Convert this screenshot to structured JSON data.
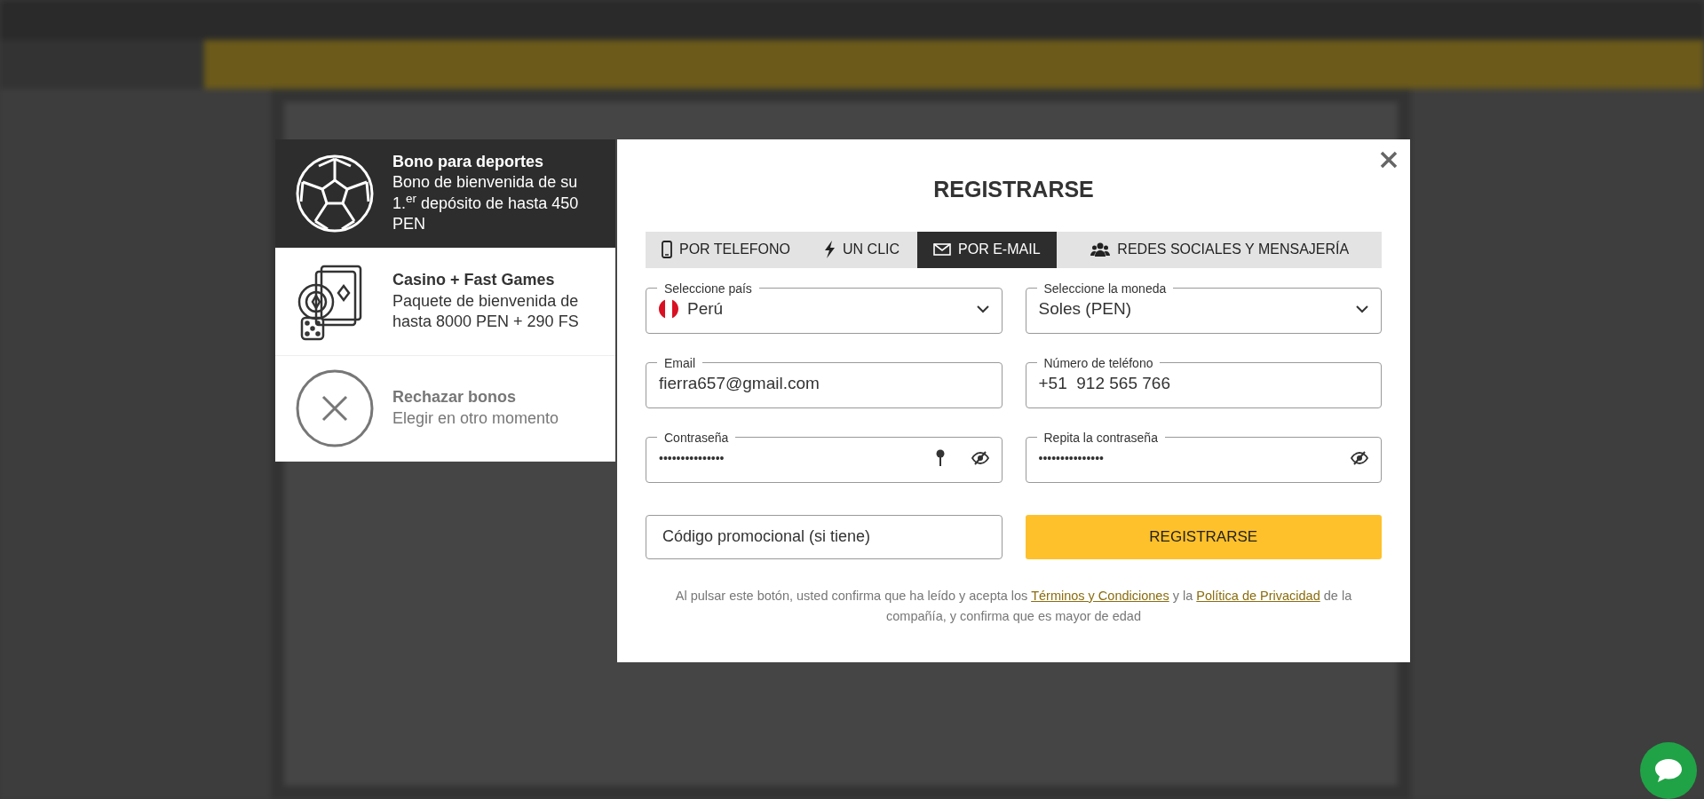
{
  "bonus_options": [
    {
      "kind": "sports",
      "title": "Bono para deportes",
      "description": "Bono de bienvenida de su 1.$^{er}$ depósito de hasta 450 PEN",
      "selected": true
    },
    {
      "kind": "casino",
      "title": "Casino + Fast Games",
      "description": "Paquete de bienvenida de hasta 8000 PEN + 290 FS",
      "selected": false
    },
    {
      "kind": "decline",
      "title": "Rechazar bonos",
      "description": "Elegir en otro momento",
      "selected": false
    }
  ],
  "dialog": {
    "title": "REGISTRARSE",
    "tabs": [
      {
        "kind": "phone",
        "label": "POR TELEFONO",
        "selected": false
      },
      {
        "kind": "oneclick",
        "label": "UN CLIC",
        "selected": false
      },
      {
        "kind": "email",
        "label": "POR E-MAIL",
        "selected": true
      },
      {
        "kind": "social",
        "label": "REDES SOCIALES Y MENSAJERÍA",
        "selected": false
      }
    ],
    "fields": [
      {
        "kind": "country",
        "label": "Seleccione país",
        "value": "Perú"
      },
      {
        "kind": "select",
        "label": "Seleccione la moneda",
        "value": "Soles (PEN)"
      },
      {
        "kind": "text",
        "label": "Email",
        "value": "fierra657@gmail.com"
      },
      {
        "kind": "text",
        "label": "Número de teléfono",
        "value": "+51  912 565 766"
      },
      {
        "kind": "password_key",
        "label": "Contraseña",
        "value": "•••••••••••••••"
      },
      {
        "kind": "password",
        "label": "Repita la contraseña",
        "value": "•••••••••••••••"
      }
    ],
    "promo": {
      "placeholder": "Código promocional (si tiene)"
    },
    "submit": "REGISTRARSE",
    "consent": [
      {
        "kind": "text",
        "text": "Al pulsar este botón, usted confirma que ha leído y acepta los "
      },
      {
        "kind": "link",
        "text": "Términos y Condiciones"
      },
      {
        "kind": "text",
        "text": " y la "
      },
      {
        "kind": "link",
        "text": "Política de Privacidad"
      },
      {
        "kind": "text",
        "text": " de la compañía, y confirma que es mayor de edad"
      }
    ]
  }
}
